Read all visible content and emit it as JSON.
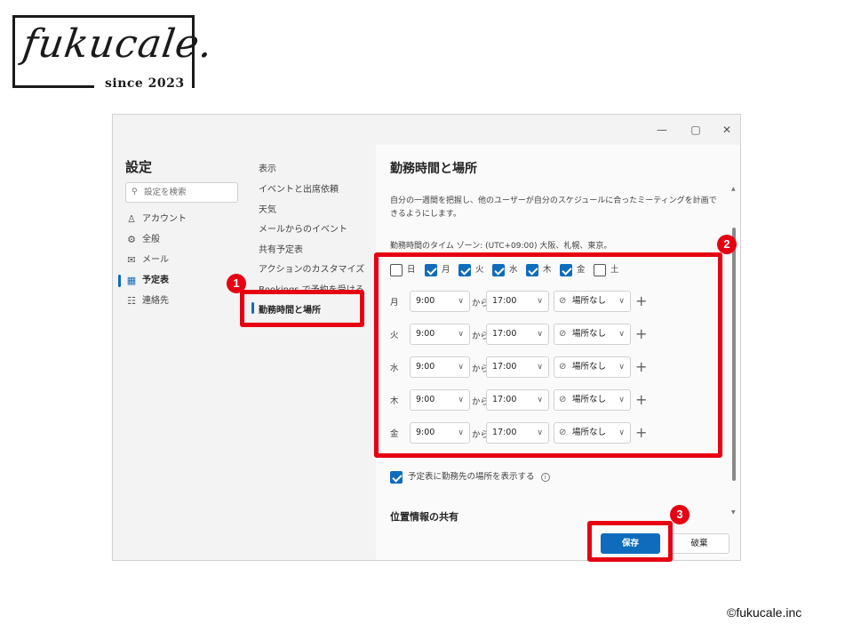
{
  "logo": {
    "script": "fukucale.",
    "since": "since 2023"
  },
  "copyright": "©fukucale.inc",
  "window": {
    "controls": {
      "minimize": "—",
      "maximize": "▢",
      "close": "✕"
    }
  },
  "settings": {
    "title": "設定",
    "search_placeholder": "設定を検索",
    "nav": [
      {
        "label": "アカウント",
        "icon": "person-icon"
      },
      {
        "label": "全般",
        "icon": "gear-icon"
      },
      {
        "label": "メール",
        "icon": "mail-icon"
      },
      {
        "label": "予定表",
        "icon": "calendar-icon",
        "active": true
      },
      {
        "label": "連絡先",
        "icon": "contacts-icon"
      }
    ]
  },
  "calendar_nav": [
    {
      "label": "表示"
    },
    {
      "label": "イベントと出席依頼"
    },
    {
      "label": "天気"
    },
    {
      "label": "メールからのイベント"
    },
    {
      "label": "共有予定表"
    },
    {
      "label": "アクションのカスタマイズ"
    },
    {
      "label": "Bookings で予約を受ける"
    },
    {
      "label": "勤務時間と場所",
      "active": true
    }
  ],
  "panel": {
    "title": "勤務時間と場所",
    "description": "自分の一週間を把握し、他のユーザーが自分のスケジュールに合ったミーティングを計画できるようにします。",
    "timezone": "勤務時間のタイム ゾーン: (UTC+09:00) 大阪、札幌、東京。",
    "days": [
      {
        "label": "日",
        "checked": false
      },
      {
        "label": "月",
        "checked": true
      },
      {
        "label": "火",
        "checked": true
      },
      {
        "label": "水",
        "checked": true
      },
      {
        "label": "木",
        "checked": true
      },
      {
        "label": "金",
        "checked": true
      },
      {
        "label": "土",
        "checked": false
      }
    ],
    "from_label": "から",
    "rows": [
      {
        "day": "月",
        "start": "9:00",
        "end": "17:00",
        "location": "場所なし"
      },
      {
        "day": "火",
        "start": "9:00",
        "end": "17:00",
        "location": "場所なし"
      },
      {
        "day": "水",
        "start": "9:00",
        "end": "17:00",
        "location": "場所なし"
      },
      {
        "day": "木",
        "start": "9:00",
        "end": "17:00",
        "location": "場所なし"
      },
      {
        "day": "金",
        "start": "9:00",
        "end": "17:00",
        "location": "場所なし"
      }
    ],
    "show_location_label": "予定表に勤務先の場所を表示する",
    "show_location_checked": true,
    "info_glyph": "i",
    "section2_title": "位置情報の共有",
    "save_label": "保存",
    "discard_label": "破棄"
  },
  "annotations": [
    {
      "number": "1"
    },
    {
      "number": "2"
    },
    {
      "number": "3"
    }
  ],
  "colors": {
    "accent": "#0f6cbd",
    "annotation": "#e60012"
  }
}
